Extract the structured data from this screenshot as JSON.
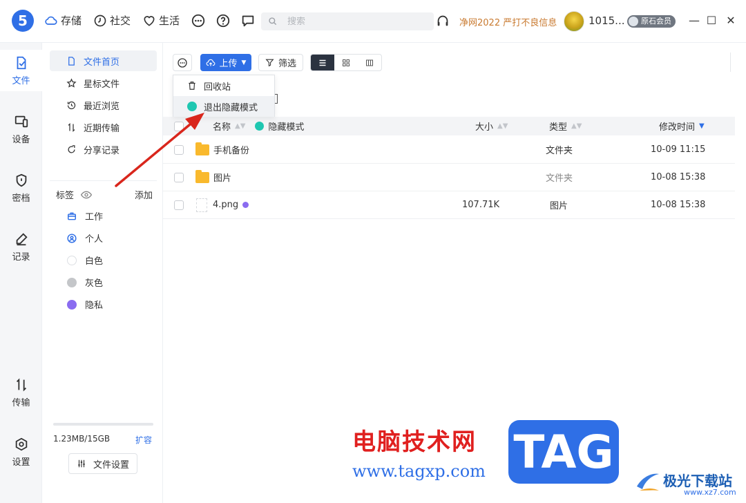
{
  "app": {
    "logo_glyph": "5",
    "nav": [
      {
        "label": "存储",
        "icon": "cloud-icon"
      },
      {
        "label": "社交",
        "icon": "clock-icon"
      },
      {
        "label": "生活",
        "icon": "heart-icon"
      }
    ],
    "search_placeholder": "搜索",
    "promo": "净网2022 严打不良信息",
    "username": "1015...",
    "vip_label": "原石会员",
    "accent": "#2f6fe6"
  },
  "rail": [
    {
      "label": "文件",
      "icon": "file-icon",
      "active": true
    },
    {
      "label": "设备",
      "icon": "device-icon"
    },
    {
      "label": "密档",
      "icon": "shield-icon"
    },
    {
      "label": "记录",
      "icon": "pen-icon"
    },
    {
      "label": "传输",
      "icon": "transfer-icon"
    },
    {
      "label": "设置",
      "icon": "settings-icon"
    }
  ],
  "sidebar": {
    "items": [
      {
        "label": "文件首页",
        "icon": "document-icon"
      },
      {
        "label": "星标文件",
        "icon": "star-icon"
      },
      {
        "label": "最近浏览",
        "icon": "history-icon"
      },
      {
        "label": "近期传输",
        "icon": "transfer-icon"
      },
      {
        "label": "分享记录",
        "icon": "share-icon"
      }
    ],
    "tags_title": "标签",
    "tags_add": "添加",
    "tags": [
      {
        "label": "工作",
        "icon": "briefcase-icon"
      },
      {
        "label": "个人",
        "icon": "person-icon"
      },
      {
        "label": "白色",
        "color": "#ffffff"
      },
      {
        "label": "灰色",
        "color": "#c4c6c9"
      },
      {
        "label": "隐私",
        "color": "#8a6cf0"
      }
    ],
    "storage": "1.23MB/15GB",
    "expand": "扩容",
    "file_settings": "文件设置"
  },
  "toolbar": {
    "upload": "上传",
    "filter": "筛选"
  },
  "menu": {
    "items": [
      {
        "label": "回收站",
        "icon": "trash-icon"
      },
      {
        "label": "退出隐藏模式",
        "icon": "hide-mode-icon"
      }
    ]
  },
  "table": {
    "headers": {
      "name": "名称",
      "hidden_mode": "隐藏模式",
      "size": "大小",
      "type": "类型",
      "time": "修改时间"
    },
    "rows": [
      {
        "name": "手机备份",
        "size": "",
        "type": "文件夹",
        "time": "10-09 11:15",
        "kind": "folder"
      },
      {
        "name": "图片",
        "size": "",
        "type": "文件夹",
        "time": "10-08 15:38",
        "kind": "folder"
      },
      {
        "name": "4.png",
        "size": "107.71K",
        "type": "图片",
        "time": "10-08 15:38",
        "kind": "file"
      }
    ]
  },
  "watermark": {
    "title": "电脑技术网",
    "url": "www.tagxp.com",
    "tag": "TAG",
    "site": "极光下载站",
    "site_url": "www.xz7.com"
  }
}
